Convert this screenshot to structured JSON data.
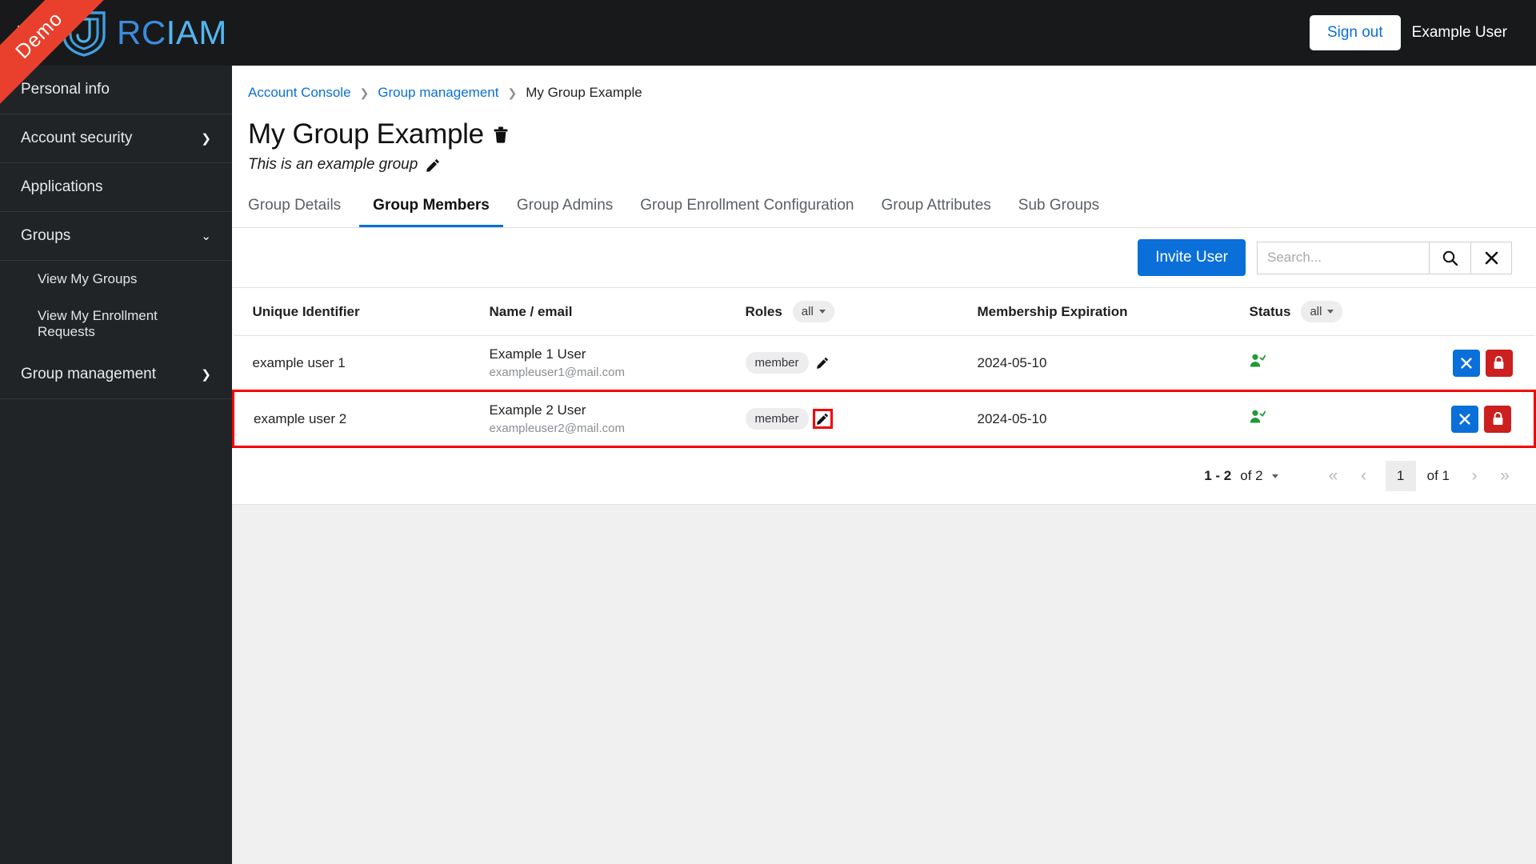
{
  "topbar": {
    "menu_icon": "hamburger-icon",
    "brand_rc": "RC",
    "brand_iam": "IAM",
    "signout_label": "Sign out",
    "user_name": "Example User",
    "ribbon_label": "Demo"
  },
  "sidebar": {
    "items": [
      {
        "label": "Personal info",
        "expandable": false,
        "arrow": ""
      },
      {
        "label": "Account security",
        "expandable": true,
        "arrow": "❯"
      },
      {
        "label": "Applications",
        "expandable": false,
        "arrow": ""
      },
      {
        "label": "Groups",
        "expandable": true,
        "arrow": "∨"
      },
      {
        "label": "View My Groups",
        "sub": true
      },
      {
        "label": "View My Enrollment Requests",
        "sub": true
      },
      {
        "label": "Group management",
        "expandable": true,
        "arrow": "❯"
      }
    ]
  },
  "breadcrumb": {
    "item1": "Account Console",
    "item2": "Group management",
    "item3": "My Group Example",
    "separator": "❯"
  },
  "page": {
    "title": "My Group Example",
    "delete_icon": "trash-icon",
    "description": "This is an example group",
    "edit_icon": "pencil-icon"
  },
  "tabs": [
    {
      "label": "Group Details",
      "active": false
    },
    {
      "label": "Group Members",
      "active": true
    },
    {
      "label": "Group Admins",
      "active": false
    },
    {
      "label": "Group Enrollment Configuration",
      "active": false
    },
    {
      "label": "Group Attributes",
      "active": false
    },
    {
      "label": "Sub Groups",
      "active": false
    }
  ],
  "toolbar": {
    "invite_label": "Invite User",
    "search_value": "",
    "search_placeholder": "Search...",
    "search_icon": "search-icon",
    "clear_icon": "close-icon"
  },
  "table": {
    "headers": {
      "unique_identifier": "Unique Identifier",
      "name_email": "Name / email",
      "roles": "Roles",
      "roles_filter": "all",
      "membership_expiration": "Membership Expiration",
      "status": "Status",
      "status_filter": "all"
    },
    "rows": [
      {
        "uid": "example user 1",
        "name": "Example 1 User",
        "email": "exampleuser1@mail.com",
        "role": "member",
        "expiration": "2024-05-10",
        "status_icon": "user-verified-icon",
        "highlighted": false,
        "edit_highlighted": false
      },
      {
        "uid": "example user 2",
        "name": "Example 2 User",
        "email": "exampleuser2@mail.com",
        "role": "member",
        "expiration": "2024-05-10",
        "status_icon": "user-verified-icon",
        "highlighted": true,
        "edit_highlighted": true
      }
    ]
  },
  "pagination": {
    "range_count": "1 - 2",
    "range_of": "of 2",
    "first_icon": "«",
    "prev_icon": "‹",
    "page": "1",
    "of_pages": "of 1",
    "next_icon": "›",
    "last_icon": "»"
  },
  "colors": {
    "accent_blue": "#0a6fd8",
    "brand_light_blue": "#53b6ee",
    "danger_red": "#cc1f1f",
    "highlight_red": "#f40000",
    "ribbon_red": "#e8402c",
    "status_green": "#1f9a37",
    "topbar_dark": "#18191b",
    "sidebar_dark": "#212427"
  }
}
